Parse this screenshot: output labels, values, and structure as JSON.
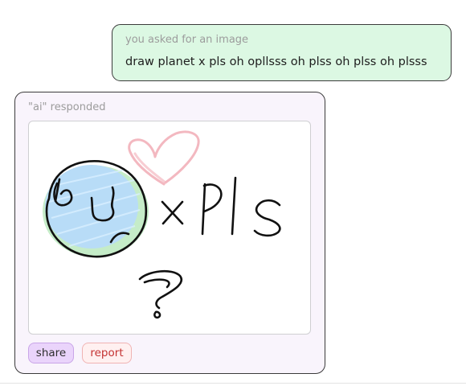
{
  "user_message": {
    "caption": "you asked for an image",
    "text": "draw planet x pls oh opllsss oh plss oh plss oh plsss"
  },
  "ai_response": {
    "caption": "\"ai\" responded",
    "share_label": "share",
    "report_label": "report"
  },
  "icons": {
    "drawing": "hand-drawn-planet-x-image",
    "heart": "heart-icon",
    "planet": "planet-doodle",
    "question": "question-mark-doodle"
  },
  "colors": {
    "user_bubble_bg": "#dcf8e3",
    "ai_card_bg": "#f9f4fc",
    "share_bg": "#ead4fb",
    "report_text": "#c43232",
    "heart_pink": "#f3b8c0",
    "planet_blue": "#a9d3f5",
    "planet_green": "#bff0bf"
  }
}
